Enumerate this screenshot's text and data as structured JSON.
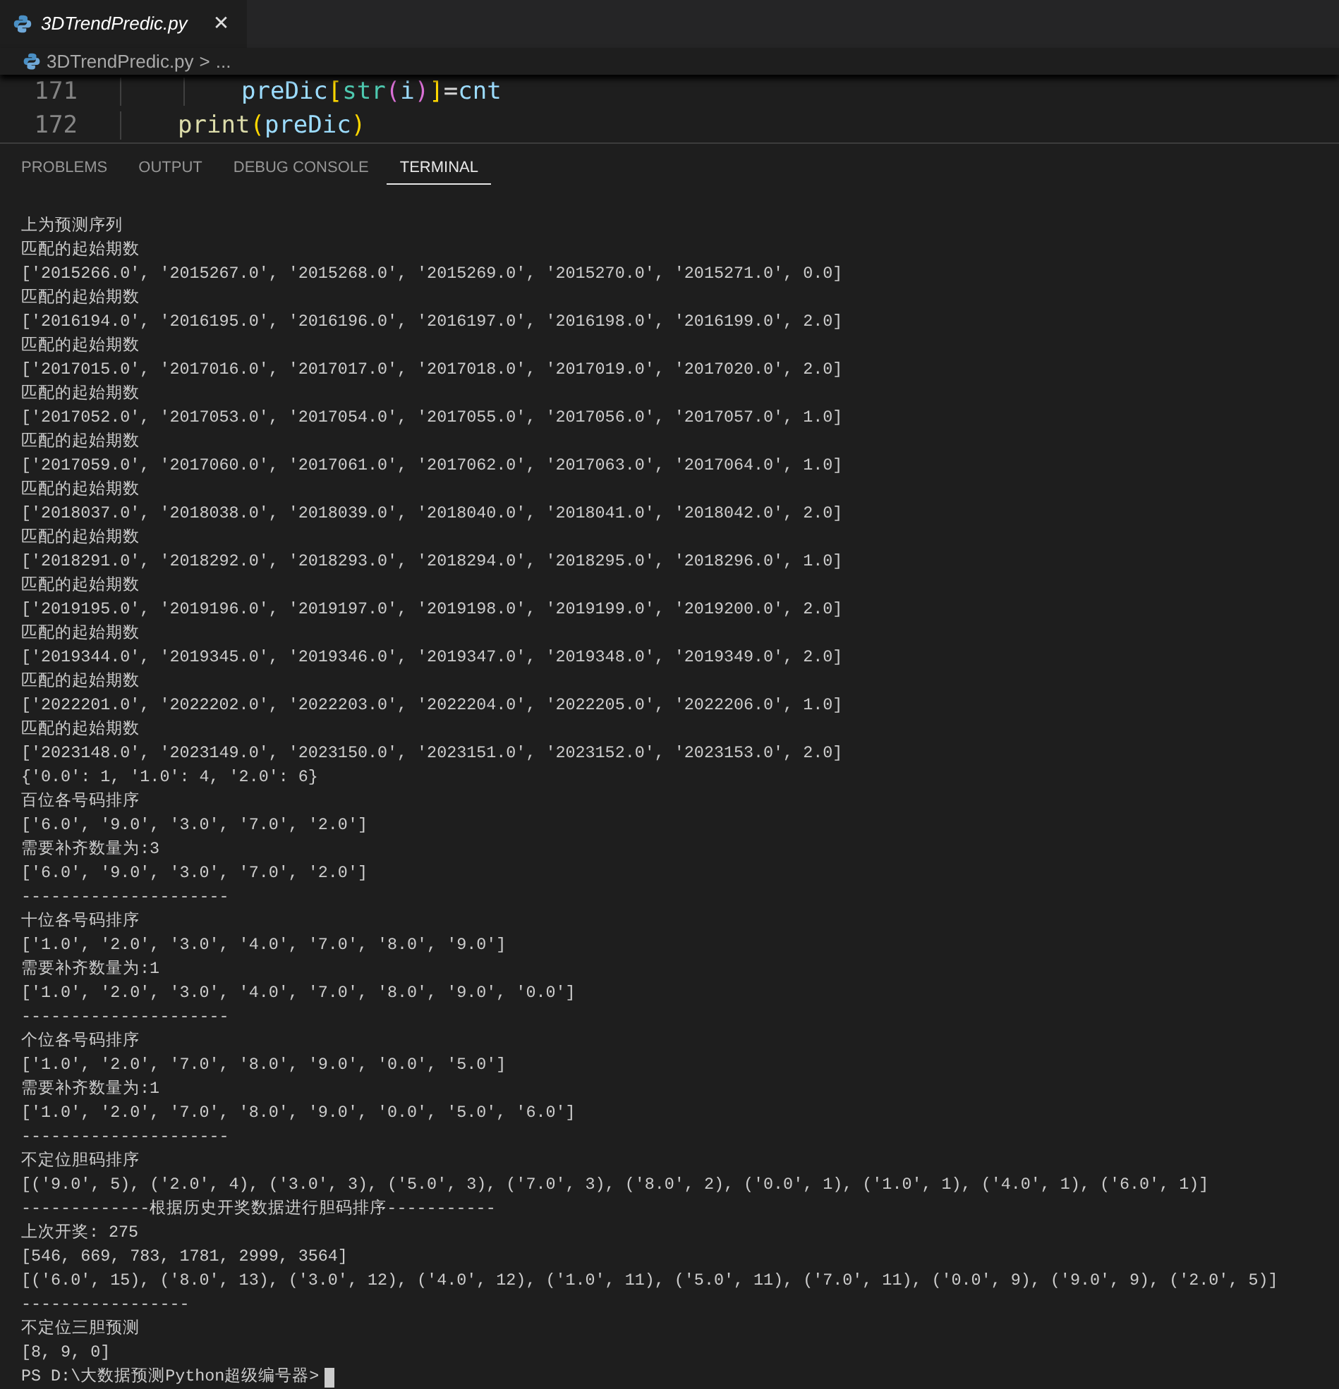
{
  "editor_tab": {
    "title": "3DTrendPredic.py",
    "selected": true,
    "close": "✕"
  },
  "breadcrumb": {
    "file": "3DTrendPredic.py",
    "separator": ">",
    "rest": "..."
  },
  "code_lines": [
    {
      "number": "171",
      "kind": "nested",
      "tokens": [
        {
          "text": "preDic",
          "color": "#9cdcfe"
        },
        {
          "text": "[",
          "color": "#ffd700"
        },
        {
          "text": "str",
          "color": "#4ec9b0"
        },
        {
          "text": "(",
          "color": "#da70d6"
        },
        {
          "text": "i",
          "color": "#9cdcfe"
        },
        {
          "text": ")",
          "color": "#da70d6"
        },
        {
          "text": "]",
          "color": "#ffd700"
        },
        {
          "text": "=",
          "color": "#d4d4d4"
        },
        {
          "text": "cnt",
          "color": "#9cdcfe"
        }
      ]
    },
    {
      "number": "172",
      "kind": "block",
      "tokens": [
        {
          "text": "print",
          "color": "#dcdcaa"
        },
        {
          "text": "(",
          "color": "#ffd700"
        },
        {
          "text": "preDic",
          "color": "#9cdcfe"
        },
        {
          "text": ")",
          "color": "#ffd700"
        }
      ]
    }
  ],
  "panel_tabs": [
    {
      "label": "PROBLEMS",
      "selected": false
    },
    {
      "label": "OUTPUT",
      "selected": false
    },
    {
      "label": "DEBUG CONSOLE",
      "selected": false
    },
    {
      "label": "TERMINAL",
      "selected": true
    }
  ],
  "terminal_lines": [
    "上为预测序列",
    "匹配的起始期数",
    "['2015266.0', '2015267.0', '2015268.0', '2015269.0', '2015270.0', '2015271.0', 0.0]",
    "匹配的起始期数",
    "['2016194.0', '2016195.0', '2016196.0', '2016197.0', '2016198.0', '2016199.0', 2.0]",
    "匹配的起始期数",
    "['2017015.0', '2017016.0', '2017017.0', '2017018.0', '2017019.0', '2017020.0', 2.0]",
    "匹配的起始期数",
    "['2017052.0', '2017053.0', '2017054.0', '2017055.0', '2017056.0', '2017057.0', 1.0]",
    "匹配的起始期数",
    "['2017059.0', '2017060.0', '2017061.0', '2017062.0', '2017063.0', '2017064.0', 1.0]",
    "匹配的起始期数",
    "['2018037.0', '2018038.0', '2018039.0', '2018040.0', '2018041.0', '2018042.0', 2.0]",
    "匹配的起始期数",
    "['2018291.0', '2018292.0', '2018293.0', '2018294.0', '2018295.0', '2018296.0', 1.0]",
    "匹配的起始期数",
    "['2019195.0', '2019196.0', '2019197.0', '2019198.0', '2019199.0', '2019200.0', 2.0]",
    "匹配的起始期数",
    "['2019344.0', '2019345.0', '2019346.0', '2019347.0', '2019348.0', '2019349.0', 2.0]",
    "匹配的起始期数",
    "['2022201.0', '2022202.0', '2022203.0', '2022204.0', '2022205.0', '2022206.0', 1.0]",
    "匹配的起始期数",
    "['2023148.0', '2023149.0', '2023150.0', '2023151.0', '2023152.0', '2023153.0', 2.0]",
    "{'0.0': 1, '1.0': 4, '2.0': 6}",
    "百位各号码排序",
    "['6.0', '9.0', '3.0', '7.0', '2.0']",
    "需要补齐数量为:3",
    "['6.0', '9.0', '3.0', '7.0', '2.0']",
    "---------------------",
    "十位各号码排序",
    "['1.0', '2.0', '3.0', '4.0', '7.0', '8.0', '9.0']",
    "需要补齐数量为:1",
    "['1.0', '2.0', '3.0', '4.0', '7.0', '8.0', '9.0', '0.0']",
    "---------------------",
    "个位各号码排序",
    "['1.0', '2.0', '7.0', '8.0', '9.0', '0.0', '5.0']",
    "需要补齐数量为:1",
    "['1.0', '2.0', '7.0', '8.0', '9.0', '0.0', '5.0', '6.0']",
    "---------------------",
    "不定位胆码排序",
    "[('9.0', 5), ('2.0', 4), ('3.0', 3), ('5.0', 3), ('7.0', 3), ('8.0', 2), ('0.0', 1), ('1.0', 1), ('4.0', 1), ('6.0', 1)]",
    "-------------根据历史开奖数据进行胆码排序-----------",
    "上次开奖: 275",
    "[546, 669, 783, 1781, 2999, 3564]",
    "[('6.0', 15), ('8.0', 13), ('3.0', 12), ('4.0', 12), ('1.0', 11), ('5.0', 11), ('7.0', 11), ('0.0', 9), ('9.0', 9), ('2.0', 5)]",
    "-----------------",
    "不定位三胆预测",
    "[8, 9, 0]"
  ],
  "prompt": "PS D:\\大数据预测Python超级编号器>"
}
